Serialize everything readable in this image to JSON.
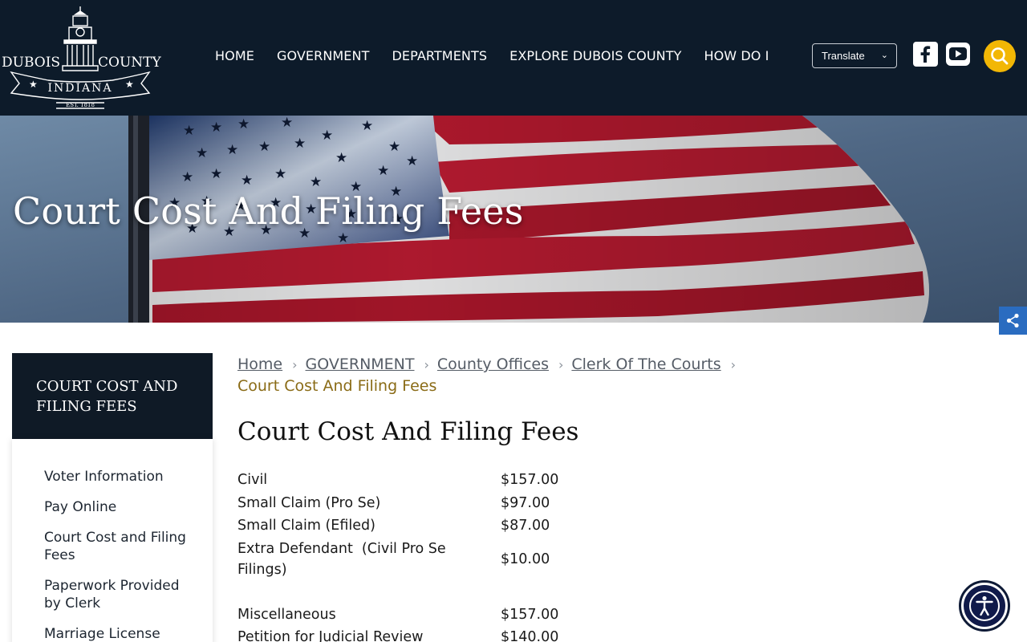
{
  "header": {
    "logo": {
      "left_text": "DUBOIS",
      "right_text": "COUNTY",
      "banner_text": "INDIANA",
      "est_text": "EST. 1818"
    },
    "nav": [
      {
        "label": "HOME"
      },
      {
        "label": "GOVERNMENT"
      },
      {
        "label": "DEPARTMENTS"
      },
      {
        "label": "EXPLORE DUBOIS COUNTY"
      },
      {
        "label": "HOW DO I"
      }
    ],
    "translate_label": "Translate",
    "icons": {
      "facebook": "facebook-icon",
      "youtube": "youtube-icon",
      "search": "search-icon",
      "share": "share-icon",
      "accessibility": "accessibility-icon"
    },
    "colors": {
      "header_bg": "#0d1b2a",
      "search_bg": "#f2b705",
      "share_bg": "#2a6cc0"
    }
  },
  "hero": {
    "title": "Court Cost And Filing Fees"
  },
  "sidebar": {
    "heading": "COURT COST AND FILING FEES",
    "items": [
      {
        "label": "Voter Information"
      },
      {
        "label": "Pay Online"
      },
      {
        "label": "Court Cost and Filing Fees"
      },
      {
        "label": "Paperwork Provided by Clerk"
      },
      {
        "label": "Marriage License"
      }
    ]
  },
  "breadcrumb": {
    "items": [
      {
        "label": "Home"
      },
      {
        "label": "GOVERNMENT"
      },
      {
        "label": "County Offices"
      },
      {
        "label": "Clerk Of The Courts"
      }
    ],
    "current": "Court Cost And Filing Fees"
  },
  "main": {
    "title": "Court Cost And Filing Fees",
    "fees": [
      {
        "label": "Civil",
        "amount": "$157.00"
      },
      {
        "label": "Small Claim (Pro Se)",
        "amount": "$97.00"
      },
      {
        "label": "Small Claim (Efiled)",
        "amount": "$87.00"
      },
      {
        "label": "Extra Defendant  (Civil Pro Se Filings)",
        "amount": "$10.00"
      },
      {
        "label": "Miscellaneous",
        "amount": "$157.00"
      },
      {
        "label": "Petition for Judicial Review",
        "amount": "$140.00"
      }
    ]
  }
}
